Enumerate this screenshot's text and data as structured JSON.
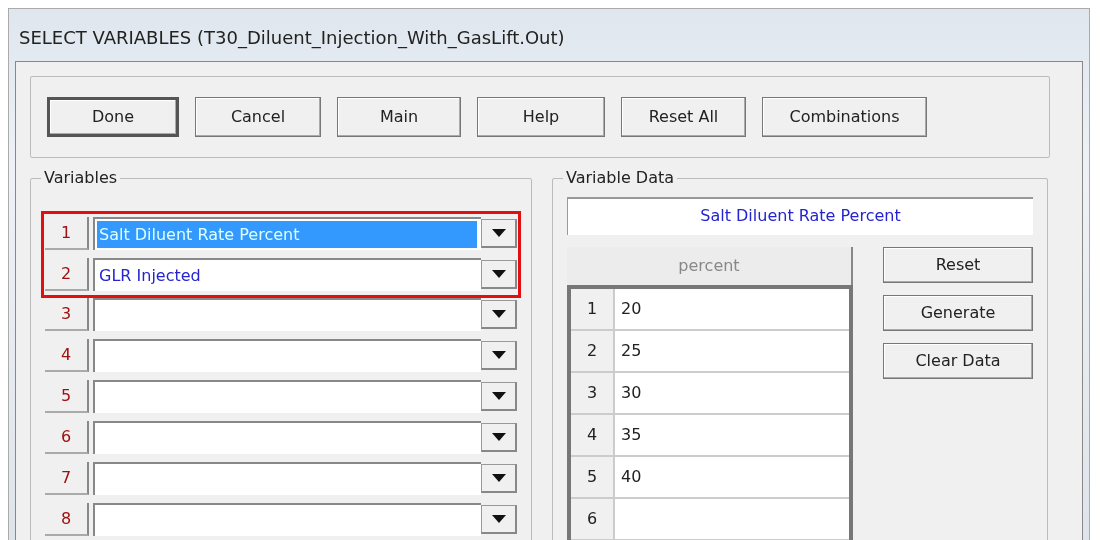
{
  "window": {
    "title": "SELECT VARIABLES (T30_Diluent_Injection_With_GasLift.Out)"
  },
  "buttons": [
    {
      "label": "Done",
      "default": true
    },
    {
      "label": "Cancel",
      "default": false
    },
    {
      "label": "Main",
      "default": false
    },
    {
      "label": "Help",
      "default": false
    },
    {
      "label": "Reset All",
      "default": false
    },
    {
      "label": "Combinations",
      "default": false
    }
  ],
  "variables": {
    "title": "Variables",
    "rows": [
      {
        "number": "1",
        "value": "Salt Diluent Rate Percent",
        "selected": true,
        "highlighted": true
      },
      {
        "number": "2",
        "value": "GLR Injected",
        "selected": false,
        "highlighted": true
      },
      {
        "number": "3",
        "selected": false,
        "highlighted": false
      },
      {
        "number": "4",
        "selected": false,
        "highlighted": false
      },
      {
        "number": "5",
        "selected": false,
        "highlighted": false
      },
      {
        "number": "6",
        "selected": false,
        "highlighted": false
      },
      {
        "number": "7",
        "selected": false,
        "highlighted": false
      },
      {
        "number": "8",
        "selected": false,
        "highlighted": false
      }
    ]
  },
  "variable_data": {
    "title": "Variable Data",
    "name": "Salt Diluent Rate Percent",
    "column_header": "percent",
    "rows": [
      {
        "number": "1",
        "value": "20"
      },
      {
        "number": "2",
        "value": "25"
      },
      {
        "number": "3",
        "value": "30"
      },
      {
        "number": "4",
        "value": "35"
      },
      {
        "number": "5",
        "value": "40"
      },
      {
        "number": "6"
      }
    ],
    "buttons": [
      "Reset",
      "Generate",
      "Clear Data"
    ]
  }
}
